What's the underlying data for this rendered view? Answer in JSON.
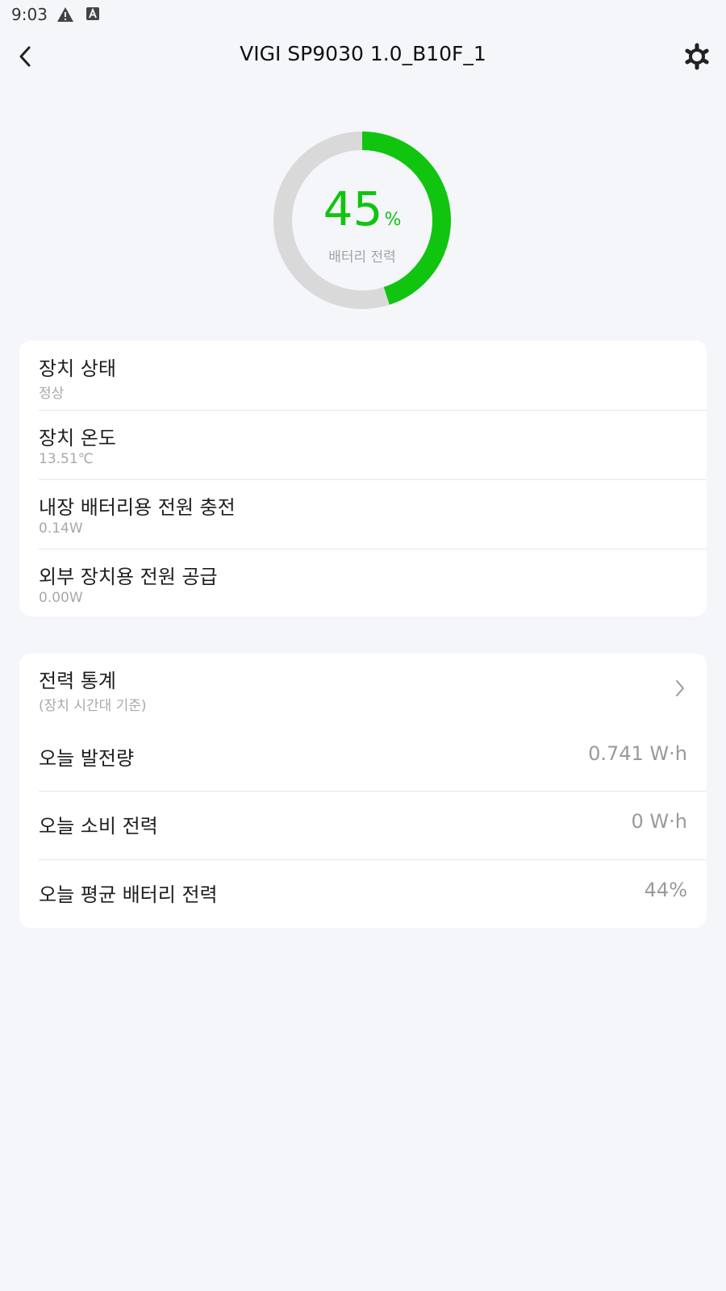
{
  "status_bar": {
    "time": "9:03",
    "icons": [
      "warning-icon",
      "keyboard-a-icon"
    ]
  },
  "header": {
    "title": "VIGI SP9030 1.0_B10F_1",
    "back_icon": "chevron-left-icon",
    "settings_icon": "gear-icon"
  },
  "battery": {
    "value": "45",
    "unit": "%",
    "label": "배터리 전력",
    "fraction": 0.45,
    "accent": "#11c40f",
    "track": "#d9d9d9"
  },
  "device_info": [
    {
      "title": "장치 상태",
      "value": "정상"
    },
    {
      "title": "장치 온도",
      "value": "13.51℃"
    },
    {
      "title": "내장 배터리용 전원 충전",
      "value": "0.14W"
    },
    {
      "title": "외부 장치용 전원 공급",
      "value": "0.00W"
    }
  ],
  "power_stats": {
    "title": "전력 통계",
    "subtitle": "(장치 시간대 기준)",
    "rows": [
      {
        "label": "오늘 발전량",
        "value": "0.741 W·h"
      },
      {
        "label": "오늘 소비 전력",
        "value": "0 W·h"
      },
      {
        "label": "오늘 평균 배터리 전력",
        "value": "44%"
      }
    ]
  }
}
